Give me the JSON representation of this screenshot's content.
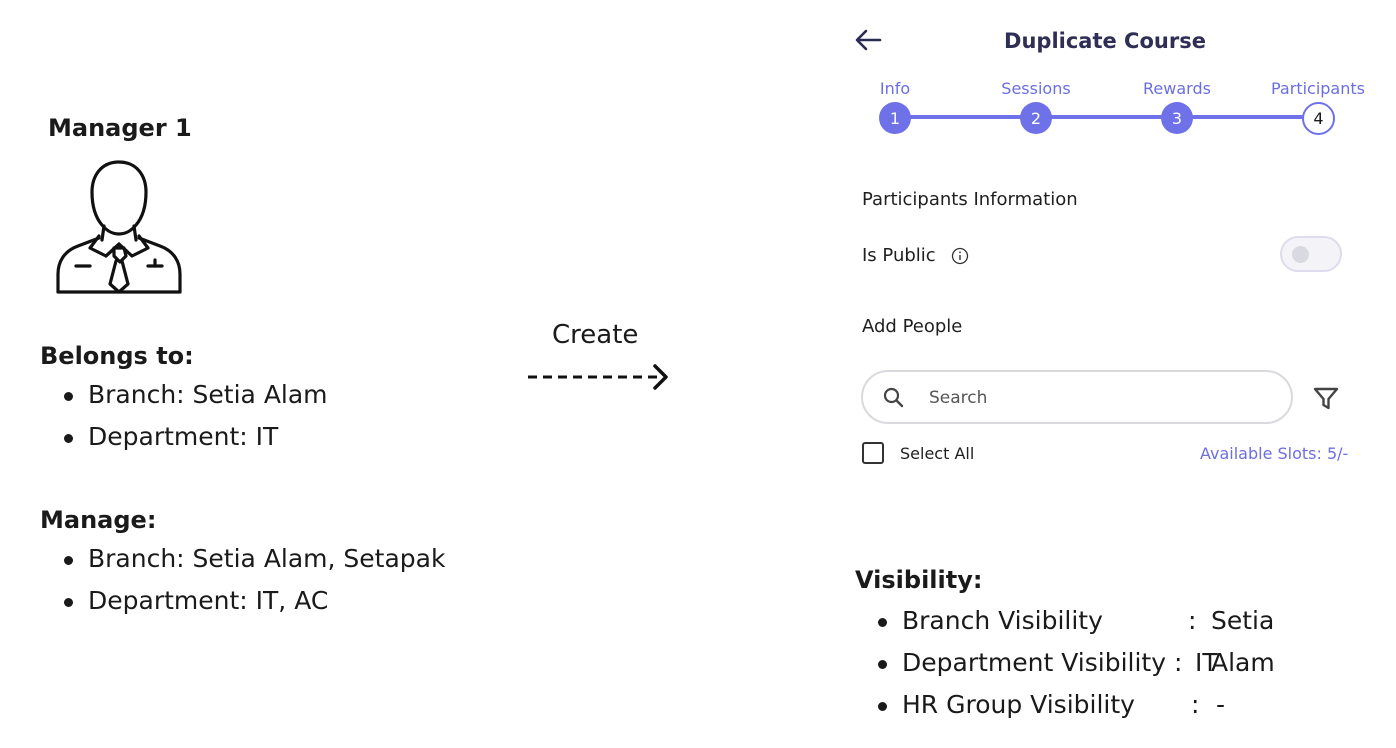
{
  "manager": {
    "title": "Manager 1",
    "icon": "manager-avatar-icon"
  },
  "belongs_to": {
    "title": "Belongs to:",
    "items": [
      "Branch: Setia Alam",
      "Department: IT"
    ]
  },
  "manage": {
    "title": "Manage:",
    "items": [
      "Branch: Setia Alam, Setapak",
      "Department: IT, AC"
    ]
  },
  "arrow": {
    "label": "Create",
    "icon": "dashed-arrow-right-icon"
  },
  "app": {
    "back_icon": "arrow-left-icon",
    "title": "Duplicate Course",
    "accent_color": "#6e71e8",
    "steps": [
      {
        "label": "Info",
        "number": "1",
        "state": "done"
      },
      {
        "label": "Sessions",
        "number": "2",
        "state": "done"
      },
      {
        "label": "Rewards",
        "number": "3",
        "state": "done"
      },
      {
        "label": "Participants",
        "number": "4",
        "state": "active"
      }
    ],
    "section_heading": "Participants Information",
    "is_public": {
      "label": "Is Public",
      "info_icon": "info-icon",
      "value": false
    },
    "add_people_label": "Add People",
    "search": {
      "placeholder": "Search",
      "value": "",
      "icon": "search-icon"
    },
    "filter_icon": "filter-icon",
    "select_all": {
      "label": "Select All",
      "checked": false
    },
    "available_slots": "Available Slots: 5/-"
  },
  "visibility": {
    "title": "Visibility:",
    "items": [
      {
        "name": "Branch Visibility",
        "sep": ":",
        "value": "Setia Alam"
      },
      {
        "name": "Department Visibility",
        "sep": ":",
        "value": "IT"
      },
      {
        "name": "HR Group Visibility",
        "sep": ":",
        "value": "-"
      }
    ]
  }
}
